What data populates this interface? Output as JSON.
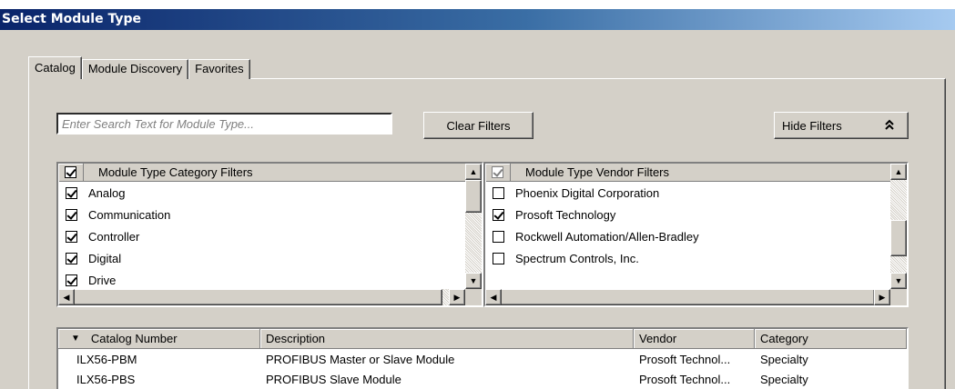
{
  "window": {
    "title": "Select Module Type"
  },
  "tabs": [
    {
      "label": "Catalog"
    },
    {
      "label": "Module Discovery"
    },
    {
      "label": "Favorites"
    }
  ],
  "search": {
    "placeholder": "Enter Search Text for Module Type..."
  },
  "buttons": {
    "clear_filters": "Clear Filters",
    "hide_filters": "Hide Filters",
    "hide_filters_icon": "double-chevron-up-icon"
  },
  "category_filters": {
    "header": "Module Type Category Filters",
    "header_checked": true,
    "items": [
      {
        "label": "Analog",
        "checked": true
      },
      {
        "label": "Communication",
        "checked": true
      },
      {
        "label": "Controller",
        "checked": true
      },
      {
        "label": "Digital",
        "checked": true
      },
      {
        "label": "Drive",
        "checked": true
      }
    ]
  },
  "vendor_filters": {
    "header": "Module Type Vendor Filters",
    "header_checked": true,
    "items": [
      {
        "label": "Phoenix Digital Corporation",
        "checked": false
      },
      {
        "label": "Prosoft Technology",
        "checked": true
      },
      {
        "label": "Rockwell Automation/Allen-Bradley",
        "checked": false
      },
      {
        "label": "Spectrum Controls, Inc.",
        "checked": false
      }
    ]
  },
  "catalog_table": {
    "sort_icon": "sort-descending-icon",
    "columns": [
      "Catalog Number",
      "Description",
      "Vendor",
      "Category"
    ],
    "rows": [
      [
        "ILX56-PBM",
        "PROFIBUS Master or Slave Module",
        "Prosoft Technol...",
        "Specialty"
      ],
      [
        "ILX56-PBS",
        "PROFIBUS Slave Module",
        "Prosoft Technol...",
        "Specialty"
      ]
    ]
  }
}
